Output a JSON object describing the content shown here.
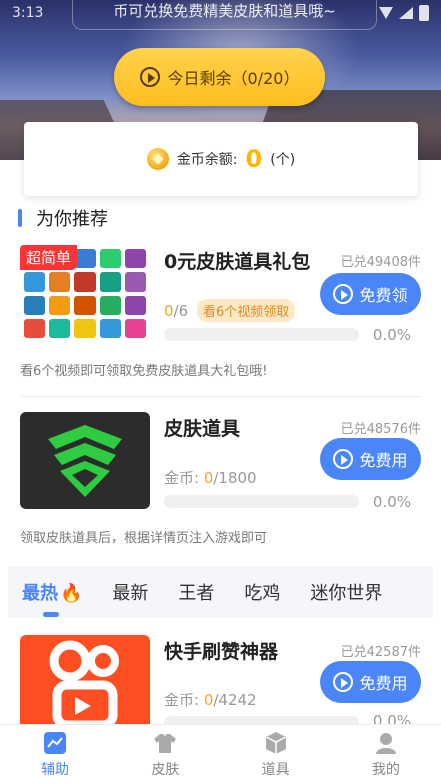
{
  "status_bar": {
    "time": "3:13"
  },
  "banner": {
    "text": "币可兑换免费精美皮肤和道具哦~"
  },
  "today_button": {
    "label": "今日剩余（0/20）"
  },
  "coin": {
    "label": "金币余额:",
    "value": "0",
    "unit": "(个)"
  },
  "section": {
    "title": "为你推荐"
  },
  "items": [
    {
      "badge": "超简单",
      "title": "0元皮肤道具礼包",
      "redeemed": "已兑49408件",
      "progress_num": "0",
      "progress_den": "/6",
      "tag": "看6个视频领取",
      "button": "免费领",
      "percent": "0.0%",
      "progress": 0,
      "desc": "看6个视频即可领取免费皮肤道具大礼包哦!"
    },
    {
      "title": "皮肤道具",
      "redeemed": "已兑48576件",
      "coin_label": "金币: ",
      "coin_have": "0",
      "coin_need": "/1800",
      "button": "免费用",
      "percent": "0.0%",
      "progress": 0,
      "desc": "领取皮肤道具后，根据详情页注入游戏即可"
    },
    {
      "title": "快手刷赞神器",
      "redeemed": "已兑42587件",
      "coin_label": "金币: ",
      "coin_have": "0",
      "coin_need": "/4242",
      "button": "免费用",
      "percent": "0.0%",
      "progress": 0
    }
  ],
  "tabs": [
    {
      "label": "最热",
      "active": true
    },
    {
      "label": "最新"
    },
    {
      "label": "王者"
    },
    {
      "label": "吃鸡"
    },
    {
      "label": "迷你世界"
    }
  ],
  "bottom_nav": [
    {
      "label": "辅助",
      "icon": "chart-icon",
      "active": true
    },
    {
      "label": "皮肤",
      "icon": "shirt-icon"
    },
    {
      "label": "道具",
      "icon": "cube-icon"
    },
    {
      "label": "我的",
      "icon": "user-icon"
    }
  ],
  "colors": {
    "accent": "#4a86f7",
    "coin": "#ffb400",
    "highlight": "#f5a623",
    "button_yellow": "#ffc726"
  }
}
